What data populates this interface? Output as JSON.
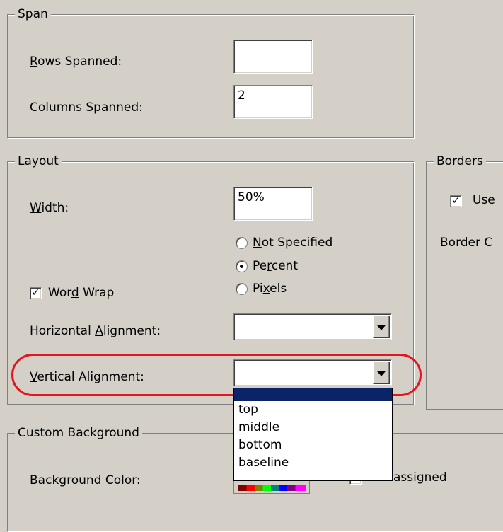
{
  "span": {
    "legend": "Span",
    "rows_label": "Rows Spanned:",
    "rows_mnemonic": "R",
    "rows_rest": "ows Spanned:",
    "rows_value": "",
    "columns_label": "Columns Spanned:",
    "columns_mnemonic": "C",
    "columns_rest": "olumns Spanned:",
    "columns_value": "2"
  },
  "layout": {
    "legend": "Layout",
    "width_mnemonic": "W",
    "width_rest": "idth:",
    "width_value": "50%",
    "radios": [
      {
        "pre": "",
        "mnemonic": "N",
        "post": "ot Specified",
        "selected": false
      },
      {
        "pre": "Pe",
        "mnemonic": "r",
        "post": "cent",
        "selected": true
      },
      {
        "pre": "Pi",
        "mnemonic": "x",
        "post": "els",
        "selected": false
      }
    ],
    "word_wrap": {
      "pre": "Wor",
      "mnemonic": "d",
      "post": " Wrap",
      "checked": true
    },
    "horizontal": {
      "pre": "Horizontal ",
      "mnemonic": "A",
      "post": "lignment:",
      "value": ""
    },
    "vertical": {
      "pre": "",
      "mnemonic": "V",
      "post": "ertical Alignment:",
      "value": ""
    },
    "vertical_options": [
      "",
      "top",
      "middle",
      "bottom",
      "baseline"
    ]
  },
  "borders": {
    "legend": "Borders",
    "use_label": "Use",
    "use_checked": true,
    "border_label": "Border C"
  },
  "custom_background": {
    "legend": "Custom Background",
    "color_pre": "Bac",
    "color_mnemonic": "k",
    "color_post": "ground Color:",
    "unassigned_text": "assigned"
  },
  "colors": {
    "highlight_ring": "#e2161e",
    "selection": "#0a246a",
    "face": "#d4d0c8"
  }
}
